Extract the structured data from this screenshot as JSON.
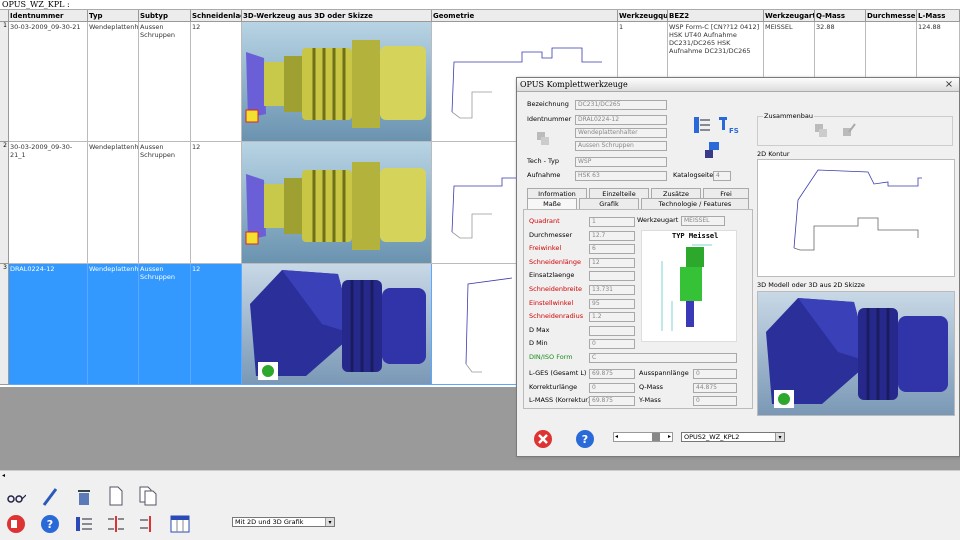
{
  "window": {
    "title": "OPUS_WZ_KPL :"
  },
  "columns": [
    "Identnummer",
    "Typ",
    "Subtyp",
    "Schneidenlae",
    "3D-Werkzeug aus 3D oder Skizze",
    "Geometrie",
    "Werkzeugqua",
    "BEZ2",
    "Werkzeugart",
    "Q-Mass",
    "Durchmesser",
    "L-Mass"
  ],
  "rows": [
    {
      "num": "1",
      "ident": "30-03-2009_09-30-21",
      "typ": "Wendeplattenhalter",
      "subtyp": "Aussen Schruppen",
      "schneide": "12",
      "qty": "1",
      "bez2": "WSP Form-C [CN??12 0412] HSK UT40 Aufnahme DC231/DC265 HSK Aufnahme DC231/DC265",
      "art": "MEISSEL",
      "q": "32.88",
      "d": "",
      "l": "124.88"
    },
    {
      "num": "2",
      "ident": "30-03-2009_09-30-21_1",
      "typ": "Wendeplattenhalter",
      "subtyp": "Aussen Schruppen",
      "schneide": "12",
      "qty": "",
      "bez2": "",
      "art": "",
      "q": "",
      "d": "",
      "l": ""
    },
    {
      "num": "3",
      "ident": "DRAL0224-12",
      "typ": "Wendeplattenhalter",
      "subtyp": "Aussen Schruppen",
      "schneide": "12",
      "qty": "",
      "bez2": "",
      "art": "",
      "q": "",
      "d": "",
      "l": ""
    }
  ],
  "dialog": {
    "title": "OPUS Komplettwerkzeuge",
    "close": "×",
    "bezeichnung_label": "Bezeichnung",
    "bezeichnung": "DC231/DC265",
    "identnummer_label": "Identnummer",
    "identnummer": "DRAL0224-12",
    "typ_value": "Wendeplattenhalter",
    "subtyp_value": "Aussen Schruppen",
    "techtyp_label": "Tech - Typ",
    "techtyp": "WSP",
    "aufnahme_label": "Aufnahme",
    "aufnahme": "HSK 63",
    "katalog_label": "Katalogseite",
    "katalog": "4",
    "zusammenbau_label": "Zusammenbau",
    "kontur_label": "2D Kontur",
    "modell_label": "3D Modell oder 3D aus 2D Skizze",
    "tabs_row1": [
      "Information",
      "Einzelteile",
      "Zusätze",
      "Frei"
    ],
    "tabs_row2": [
      "Maße",
      "Grafik",
      "Technologie / Features"
    ],
    "werkzeugart_label": "Werkzeugart",
    "werkzeugart": "MEISSEL",
    "params": [
      {
        "label": "Quadrant",
        "value": "1",
        "color": "red"
      },
      {
        "label": "Durchmesser",
        "value": "12.7",
        "color": "black"
      },
      {
        "label": "Freiwinkel",
        "value": "6",
        "color": "red"
      },
      {
        "label": "Schneidenlänge",
        "value": "12",
        "color": "red"
      },
      {
        "label": "Einsatzlaenge",
        "value": "",
        "color": "black"
      },
      {
        "label": "Schneidenbreite",
        "value": "13.731",
        "color": "red"
      },
      {
        "label": "Einstellwinkel",
        "value": "95",
        "color": "red"
      },
      {
        "label": "Schneidenradius",
        "value": "1.2",
        "color": "red"
      },
      {
        "label": "D Max",
        "value": "",
        "color": "black"
      },
      {
        "label": "D Min",
        "value": "0",
        "color": "black"
      }
    ],
    "din_label": "DIN/ISO Form",
    "din_value": "C",
    "lges_label": "L-GES (Gesamt L)",
    "lges": "69.875",
    "korrektur_label": "Korrekturlänge",
    "korrektur": "0",
    "lmass_label": "L-MASS (Korrektur)",
    "lmass": "69.875",
    "ausspann_label": "Ausspannlänge",
    "ausspann": "0",
    "qmass_label": "Q-Mass",
    "qmass": "44.875",
    "ymass_label": "Y-Mass",
    "ymass": "0",
    "diagram_title": "TYP Meissel",
    "footer_select": "OPUS2_WZ_KPL2"
  },
  "bottom": {
    "select": "Mit 2D und 3D Grafik"
  }
}
